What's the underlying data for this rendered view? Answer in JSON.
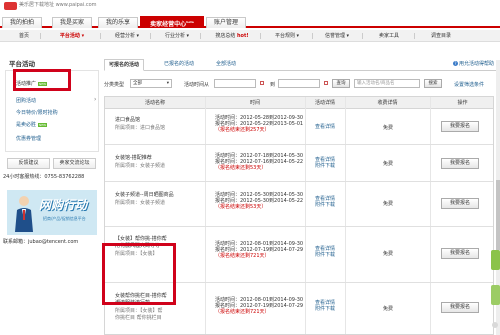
{
  "logo": {
    "text": "美乐居下载地址 www.paipai.com"
  },
  "tabs": [
    {
      "label": "我的拍拍"
    },
    {
      "label": "我是买家"
    },
    {
      "label": "我的乐享"
    },
    {
      "label": "卖家经营中心",
      "badge": "beta"
    },
    {
      "label": "账户管理"
    }
  ],
  "nav": [
    {
      "label": "首页"
    },
    {
      "label": "平台活动 ▾"
    },
    {
      "label": "经营分析 ▾"
    },
    {
      "label": "行业分析 ▾"
    },
    {
      "label": "搜店总结 ",
      "hot": "hot!"
    },
    {
      "label": "平台规则 ▾"
    },
    {
      "label": "信誉管理 ▾"
    },
    {
      "label": "卖家工具"
    },
    {
      "label": "调查目录"
    }
  ],
  "sidebar": {
    "title": "平台活动",
    "items": [
      {
        "label": "活动推广",
        "badge": "NEW"
      },
      {
        "label": "团购活动"
      },
      {
        "label": "今日特价/限时抢购"
      },
      {
        "label": "是卖必胜",
        "badge": "NEW"
      },
      {
        "label": "优惠券管理"
      }
    ],
    "btn_feedback": "反馈建议",
    "btn_exchange": "卖家交流论坛",
    "hotline": "24小时客服热线：0755-83762288",
    "promo_big": "网购行动",
    "promo_sub": "招商/产品/促销信息平台",
    "mail": "联系邮箱：jubao@tencent.com"
  },
  "main_tabs": [
    {
      "label": "可报名的活动"
    },
    {
      "label": "已报名的活动"
    },
    {
      "label": "全部活动"
    }
  ],
  "help": {
    "icon": "help-icon",
    "label": "用允活动得帮助"
  },
  "filter": {
    "type_label": "分类类型",
    "type_value": "全部",
    "time_label": "活动时间从",
    "to_label": "到",
    "query_btn": "查询",
    "search_placeholder": "输入活动名/商品名",
    "search_btn": "搜索",
    "more": "设置筛选条件"
  },
  "table": {
    "headers": [
      "活动名称",
      "时间",
      "活动详情",
      "收费详情",
      "操作"
    ],
    "rows": [
      {
        "name": "进口食品馆",
        "sub": "所属项目：进口食品馆",
        "act": "活动时间：2012-05-28到2012-09-30",
        "sign": "报名时间：2012-05-22到2013-05-01",
        "left": "（报名结束还剩257天）",
        "detail1": "查看详情",
        "detail2": "",
        "fee": "免费",
        "op": "我要报名"
      },
      {
        "name": "女装馆-搭配推荐",
        "sub": "所属项目：女装子频道",
        "act": "活动时间：2012-07-18到2014-05-30",
        "sign": "报名时间：2012-07-16到2014-05-22",
        "left": "（报名结束还剩53天）",
        "detail1": "查看详情",
        "detail2": "附件下载",
        "fee": "免费",
        "op": "我要报名"
      },
      {
        "name": "女装子频道--周日晒图商品",
        "sub": "所属项目：女装子频道",
        "act": "活动时间：2012-05-30到2014-05-30",
        "sign": "报名时间：2012-05-30到2014-05-22",
        "left": "（报名结束还剩53天）",
        "detail1": "查看详情",
        "detail2": "附件下载",
        "fee": "免费",
        "op": "我要报名"
      },
      {
        "name": "【女装】帮你挑-搭你帮\n用礼服风骚大码等等",
        "sub": "所属项目：【女装】",
        "act": "活动时间：2012-08-01到2014-09-30",
        "sign": "报名时间：2012-07-19到2014-07-29",
        "left": "（报名结束还剩721天）",
        "detail1": "查看详情",
        "detail2": "附件下载",
        "fee": "免费",
        "op": "我要报名"
      },
      {
        "name": "女装帮你挑栏目-搭你帮\n潮流服装流行款",
        "sub": "所属项目：【女装】帮",
        "sub2": "你挑栏目 帮你挑栏目",
        "act": "活动时间：2012-08-01到2014-09-30",
        "sign": "报名时间：2012-07-19到2014-07-29",
        "left": "（报名结束还剩721天）",
        "detail1": "查看详情",
        "detail2": "附件下载",
        "fee": "免费",
        "op": "我要报名"
      }
    ]
  }
}
